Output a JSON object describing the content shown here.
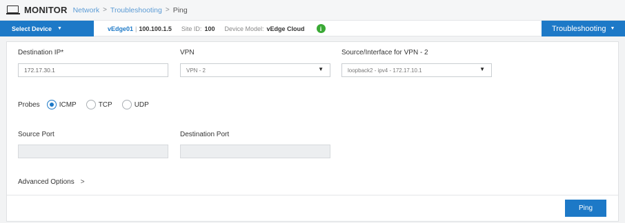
{
  "header": {
    "app_title": "MONITOR",
    "icon": "monitor-icon",
    "breadcrumb": [
      "Network",
      "Troubleshooting",
      "Ping"
    ],
    "separator": ">"
  },
  "device_bar": {
    "select_device_label": "Select Device",
    "device_name": "vEdge01",
    "separator": "|",
    "device_ip": "100.100.1.5",
    "site_id_label": "Site ID:",
    "site_id": "100",
    "device_model_label": "Device Model:",
    "device_model": "vEdge Cloud",
    "info_glyph": "i",
    "troubleshooting_label": "Troubleshooting"
  },
  "form": {
    "destination_ip": {
      "label": "Destination IP*",
      "value": "172.17.30.1"
    },
    "vpn": {
      "label": "VPN",
      "value": "VPN - 2"
    },
    "source_interface": {
      "label": "Source/Interface for VPN - 2",
      "value": "loopback2 - ipv4 - 172.17.10.1"
    },
    "probes": {
      "label": "Probes",
      "options": [
        "ICMP",
        "TCP",
        "UDP"
      ],
      "selected": "ICMP"
    },
    "source_port": {
      "label": "Source Port",
      "value": ""
    },
    "destination_port": {
      "label": "Destination Port",
      "value": ""
    },
    "advanced_options_label": "Advanced Options",
    "advanced_chevron": ">",
    "ping_label": "Ping"
  },
  "colors": {
    "accent": "#1d79c7",
    "info_green": "#3aa935"
  }
}
